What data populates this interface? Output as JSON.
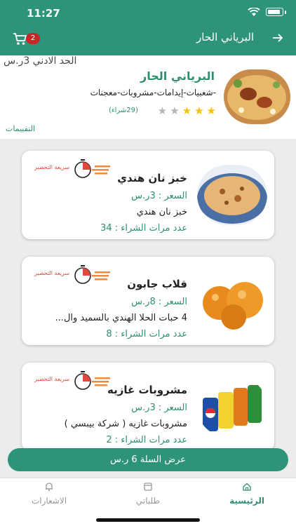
{
  "status_bar": {
    "time": "11:27"
  },
  "header": {
    "title": "البرياني الحار",
    "back_icon": "arrow-right-icon",
    "cart_count": "2",
    "accent_color": "#2e9479"
  },
  "restaurant": {
    "name": "البرياني الحار",
    "categories": "-شعبيات-إيدامات-مشروبات-معجنات",
    "min_order": "الحد الادني 3ر.س",
    "rating_count": "(29شراء)",
    "stars_filled": 3,
    "stars_total": 5,
    "ratings_link": "التقييمات"
  },
  "items": [
    {
      "name": "خبز نان هندي",
      "price": "السعر : 3ر.س",
      "description": "خبز نان هندي",
      "purchases": "عدد مرات الشراء : 34",
      "prep_label": "سريعة التحضير"
    },
    {
      "name": "قلاب جابون",
      "price": "السعر : 8ر.س",
      "description": "4 حبات الحلا الهندي بالسميد وال...",
      "purchases": "عدد مرات الشراء : 8",
      "prep_label": "سريعة التحضير"
    },
    {
      "name": "مشروبات غازيه",
      "price": "السعر : 3ر.س",
      "description": "مشروبات غازيه ( شركة بيبسي )",
      "purchases": "عدد مرات الشراء : 2",
      "prep_label": "سريعة التحضير"
    }
  ],
  "cart_bar": {
    "label": "عرض السلة 6 ر.س"
  },
  "tabs": [
    {
      "label": "الرئيسية",
      "icon": "home-icon",
      "active": true
    },
    {
      "label": "طلباتي",
      "icon": "orders-icon",
      "active": false
    },
    {
      "label": "الاشعارات",
      "icon": "bell-icon",
      "active": false
    }
  ]
}
